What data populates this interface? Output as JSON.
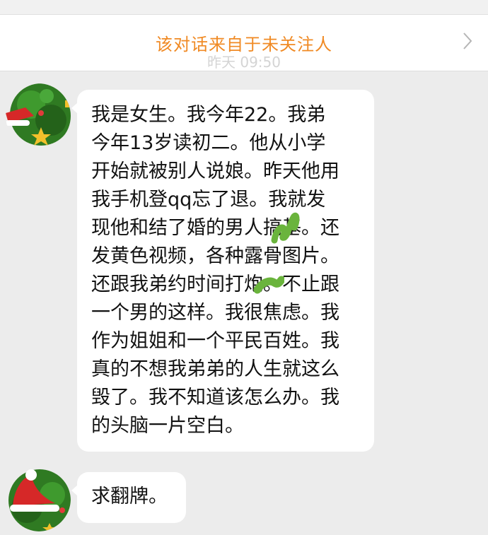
{
  "notice": {
    "text": "该对话来自于未关注人"
  },
  "timestamp": "昨天 09:50",
  "messages": [
    {
      "lines": [
        "我是女生。我今年22。我弟",
        "今年13岁读初二。他从小学",
        "开始就被别人说娘。昨天他用",
        "我手机登qq忘了退。我就发",
        "现他和结了婚的男人搞基。还",
        "发黄色视频，各种露骨图片。",
        "还跟我弟约时间打炮。不止跟",
        "一个男的这样。我很焦虑。我",
        "作为姐姐和一个平民百姓。我",
        "真的不想我弟弟的人生就这么",
        "毁了。我不知道该怎么办。我",
        "的头脑一片空白。"
      ]
    },
    {
      "lines": [
        "求翻牌。"
      ]
    }
  ],
  "icons": {
    "chevron": "chevron-right-icon",
    "avatar": "christmas-tree-santa-hat-avatar"
  },
  "colors": {
    "notice_text": "#f08a24",
    "background": "#ececec",
    "bubble": "#ffffff",
    "scribble": "#6ab43c"
  }
}
